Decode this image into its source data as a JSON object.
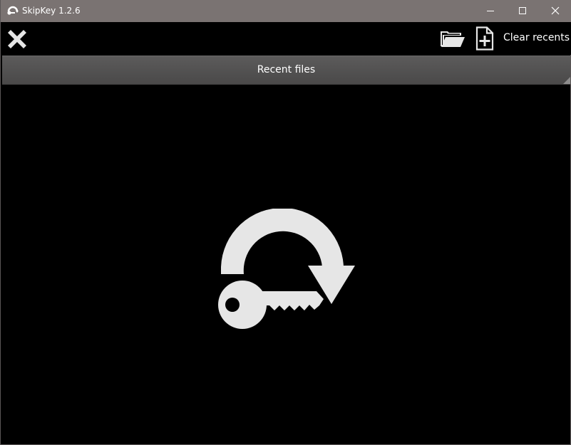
{
  "window": {
    "title": "SkipKey 1.2.6"
  },
  "toolbar": {
    "clear_recents_label": "Clear recents"
  },
  "recent": {
    "header_label": "Recent files"
  },
  "colors": {
    "titlebar": "#7a7372",
    "background": "#000000",
    "header": "#555454",
    "icon": "#e6e6e6",
    "text": "#ffffff"
  },
  "icons": [
    "app-logo-icon",
    "minimize-icon",
    "maximize-icon",
    "close-icon",
    "close-x-icon",
    "open-folder-icon",
    "new-file-icon",
    "key-rotate-logo-icon"
  ]
}
